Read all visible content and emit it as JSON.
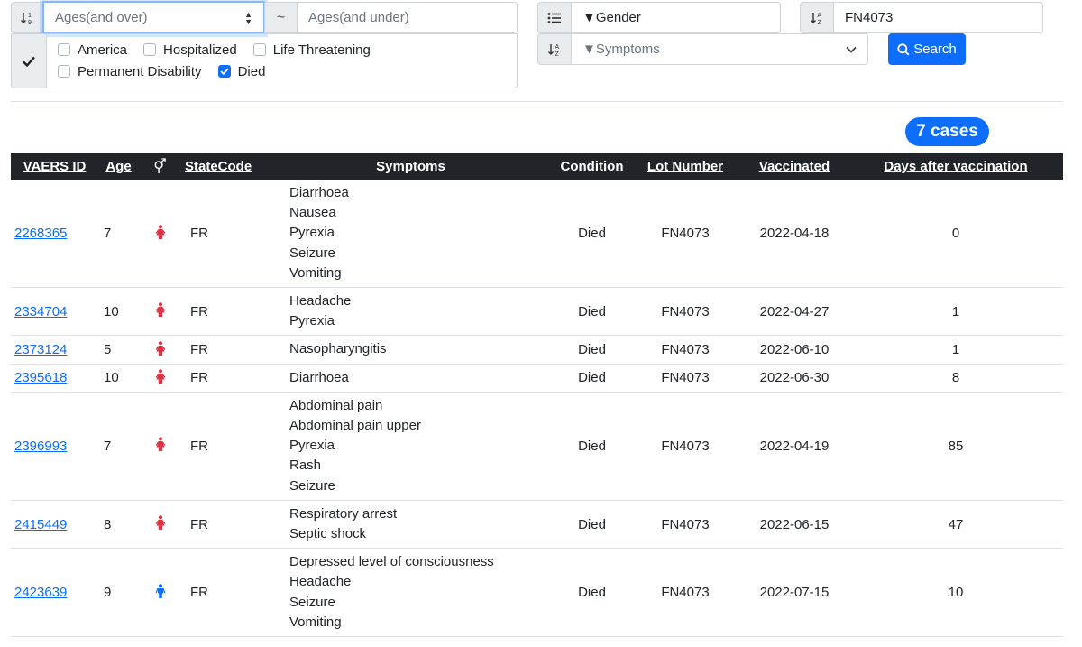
{
  "filters": {
    "age_over_placeholder": "Ages(and over)",
    "tilde": "~",
    "age_under_placeholder": "Ages(and under)",
    "gender_value": "▼Gender",
    "lot_value": "FN4073",
    "symptoms_value": "▼Symptoms",
    "checkboxes": [
      {
        "label": "America",
        "checked": false
      },
      {
        "label": "Hospitalized",
        "checked": false
      },
      {
        "label": "Life Threatening",
        "checked": false
      },
      {
        "label": "Permanent Disability",
        "checked": false
      },
      {
        "label": "Died",
        "checked": true
      }
    ],
    "search_label": "Search"
  },
  "cases_badge": "7 cases",
  "table": {
    "headers": {
      "vaers_id": "VAERS ID",
      "age": "Age",
      "gender_icon": "⚥",
      "state": "StateCode",
      "symptoms": "Symptoms",
      "condition": "Condition",
      "lot": "Lot Number",
      "vaccinated": "Vaccinated",
      "days": "Days after vaccination"
    },
    "rows": [
      {
        "id": "2268365",
        "age": "7",
        "gender": "female",
        "state": "FR",
        "symptoms": [
          "Diarrhoea",
          "Nausea",
          "Pyrexia",
          "Seizure",
          "Vomiting"
        ],
        "condition": "Died",
        "lot": "FN4073",
        "vaccinated": "2022-04-18",
        "days": "0"
      },
      {
        "id": "2334704",
        "age": "10",
        "gender": "female",
        "state": "FR",
        "symptoms": [
          "Headache",
          "Pyrexia"
        ],
        "condition": "Died",
        "lot": "FN4073",
        "vaccinated": "2022-04-27",
        "days": "1"
      },
      {
        "id": "2373124",
        "age": "5",
        "gender": "female",
        "state": "FR",
        "symptoms": [
          "Nasopharyngitis"
        ],
        "condition": "Died",
        "lot": "FN4073",
        "vaccinated": "2022-06-10",
        "days": "1"
      },
      {
        "id": "2395618",
        "age": "10",
        "gender": "female",
        "state": "FR",
        "symptoms": [
          "Diarrhoea"
        ],
        "condition": "Died",
        "lot": "FN4073",
        "vaccinated": "2022-06-30",
        "days": "8"
      },
      {
        "id": "2396993",
        "age": "7",
        "gender": "female",
        "state": "FR",
        "symptoms": [
          "Abdominal pain",
          "Abdominal pain upper",
          "Pyrexia",
          "Rash",
          "Seizure"
        ],
        "condition": "Died",
        "lot": "FN4073",
        "vaccinated": "2022-04-19",
        "days": "85"
      },
      {
        "id": "2415449",
        "age": "8",
        "gender": "female",
        "state": "FR",
        "symptoms": [
          "Respiratory arrest",
          "Septic shock"
        ],
        "condition": "Died",
        "lot": "FN4073",
        "vaccinated": "2022-06-15",
        "days": "47"
      },
      {
        "id": "2423639",
        "age": "9",
        "gender": "male",
        "state": "FR",
        "symptoms": [
          "Depressed level of consciousness",
          "Headache",
          "Seizure",
          "Vomiting"
        ],
        "condition": "Died",
        "lot": "FN4073",
        "vaccinated": "2022-07-15",
        "days": "10"
      }
    ]
  },
  "colors": {
    "female": "#dc3545",
    "male": "#0d6efd",
    "accent": "#0d6efd",
    "header_bg": "#212529"
  }
}
